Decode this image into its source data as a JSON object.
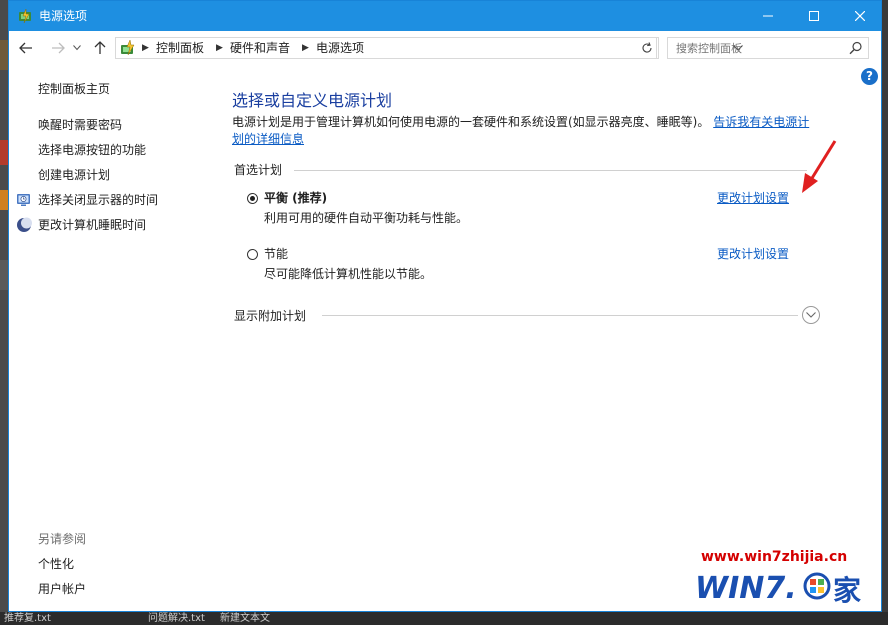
{
  "window": {
    "title": "电源选项",
    "controls": {
      "minimize": "minimize",
      "maximize": "maximize",
      "close": "close"
    }
  },
  "address": {
    "breadcrumbs": [
      "控制面板",
      "硬件和声音",
      "电源选项"
    ],
    "search_placeholder": "搜索控制面板"
  },
  "help_label": "?",
  "sidebar": {
    "home": "控制面板主页",
    "links": [
      "唤醒时需要密码",
      "选择电源按钮的功能",
      "创建电源计划",
      "选择关闭显示器的时间",
      "更改计算机睡眠时间"
    ],
    "see_also_title": "另请参阅",
    "see_also": [
      "个性化",
      "用户帐户"
    ]
  },
  "main": {
    "heading": "选择或自定义电源计划",
    "description": "电源计划是用于管理计算机如何使用电源的一套硬件和系统设置(如显示器亮度、睡眠等)。",
    "description_link": "告诉我有关电源计划的详细信息",
    "preferred_label": "首选计划",
    "plans": [
      {
        "name": "平衡 (推荐)",
        "desc": "利用可用的硬件自动平衡功耗与性能。",
        "link": "更改计划设置",
        "selected": true
      },
      {
        "name": "节能",
        "desc": "尽可能降低计算机性能以节能。",
        "link": "更改计划设置",
        "selected": false
      }
    ],
    "additional_label": "显示附加计划"
  },
  "watermark": {
    "url": "www.win7zhijia.cn",
    "logo_text": "WIN7.",
    "logo_cn": "家"
  },
  "taskbar": {
    "items": [
      "推荐复.txt",
      "问题解决.txt",
      "新建文本文"
    ]
  },
  "colors": {
    "titlebar": "#1e8fe1",
    "link": "#0a5bc4",
    "heading": "#1a3fa0",
    "annotation_arrow": "#e02020",
    "watermark_red": "#d40000",
    "watermark_blue": "#1a4fb0"
  }
}
